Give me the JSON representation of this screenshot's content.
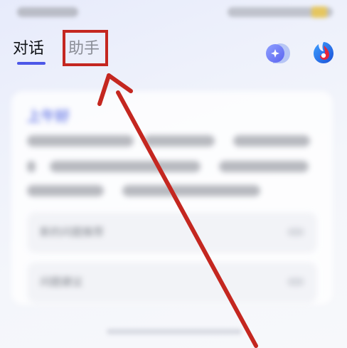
{
  "tabs": {
    "chat_label": "对话",
    "assistant_label": "助手"
  },
  "icons": {
    "new_chat": "new-chat-icon",
    "app": "app-logo-icon"
  },
  "card": {
    "title": "上午好",
    "items": [
      {
        "label": "新的问题推荐"
      },
      {
        "label": "问题建议"
      }
    ]
  },
  "colors": {
    "accent": "#4c57e8",
    "annotation_red": "#c42720"
  }
}
